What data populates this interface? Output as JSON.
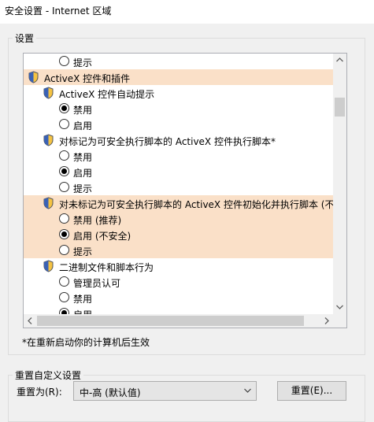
{
  "window": {
    "title": "安全设置 - Internet 区域"
  },
  "settings_group": {
    "legend": "设置"
  },
  "settings_list": {
    "rows": [
      {
        "text": "提示"
      },
      {
        "text": "ActiveX 控件和插件"
      },
      {
        "text": "ActiveX 控件自动提示"
      },
      {
        "text": "禁用"
      },
      {
        "text": "启用"
      },
      {
        "text": "对标记为可安全执行脚本的 ActiveX 控件执行脚本*"
      },
      {
        "text": "禁用"
      },
      {
        "text": "启用"
      },
      {
        "text": "提示"
      },
      {
        "text": "对未标记为可安全执行脚本的 ActiveX 控件初始化并执行脚本 (不安全)"
      },
      {
        "text": "禁用 (推荐)"
      },
      {
        "text": "启用 (不安全)"
      },
      {
        "text": "提示"
      },
      {
        "text": "二进制文件和脚本行为"
      },
      {
        "text": "管理员认可"
      },
      {
        "text": "禁用"
      },
      {
        "text": "启用"
      }
    ],
    "selected_options": [
      "禁用",
      "启用",
      "启用 (不安全)",
      "启用"
    ],
    "highlight_color": "#fae0c8",
    "icon": "shield-icon"
  },
  "restart_note": "*在重新启动你的计算机后生效",
  "reset_group": {
    "legend": "重置自定义设置",
    "label": "重置为(R):",
    "selected_level": "中-高 (默认值)",
    "reset_button": "重置(E)..."
  }
}
